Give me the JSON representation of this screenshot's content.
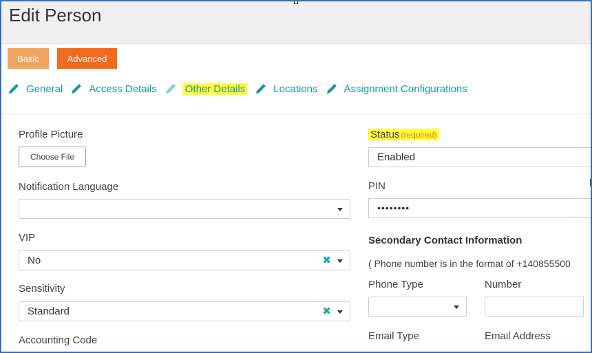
{
  "header": {
    "title": "Edit Person"
  },
  "modes": {
    "basic_label": "Basic",
    "advanced_label": "Advanced"
  },
  "tabs": [
    {
      "label": "General",
      "highlighted": false
    },
    {
      "label": "Access Details",
      "highlighted": false
    },
    {
      "label": "Other Details",
      "highlighted": true
    },
    {
      "label": "Locations",
      "highlighted": false
    },
    {
      "label": "Assignment Configurations",
      "highlighted": false
    }
  ],
  "left": {
    "profile_picture_label": "Profile Picture",
    "choose_file_label": "Choose File",
    "notification_language_label": "Notification Language",
    "notification_language_value": "",
    "vip_label": "VIP",
    "vip_value": "No",
    "sensitivity_label": "Sensitivity",
    "sensitivity_value": "Standard",
    "accounting_code_label": "Accounting Code"
  },
  "right": {
    "status_label": "Status",
    "status_required": "(required)",
    "status_value": "Enabled",
    "pin_label": "PIN",
    "pin_value": "••••••••",
    "secondary_contact_heading": "Secondary Contact Information",
    "phone_hint": "( Phone number is in the format of +140855500",
    "phone_type_label": "Phone Type",
    "phone_type_value": "",
    "number_label": "Number",
    "number_value": "",
    "email_type_label": "Email Type",
    "email_address_label": "Email Address"
  },
  "colors": {
    "accent": "#1a93a3",
    "basic_button": "#f0a460",
    "advanced_button": "#f26b1d",
    "highlight": "#ffff3a",
    "required": "#e07b1a"
  },
  "icons": {
    "tab_icon": "pencil-icon",
    "clear_icon": "clear-x-icon",
    "caret_icon": "chevron-down-icon"
  }
}
